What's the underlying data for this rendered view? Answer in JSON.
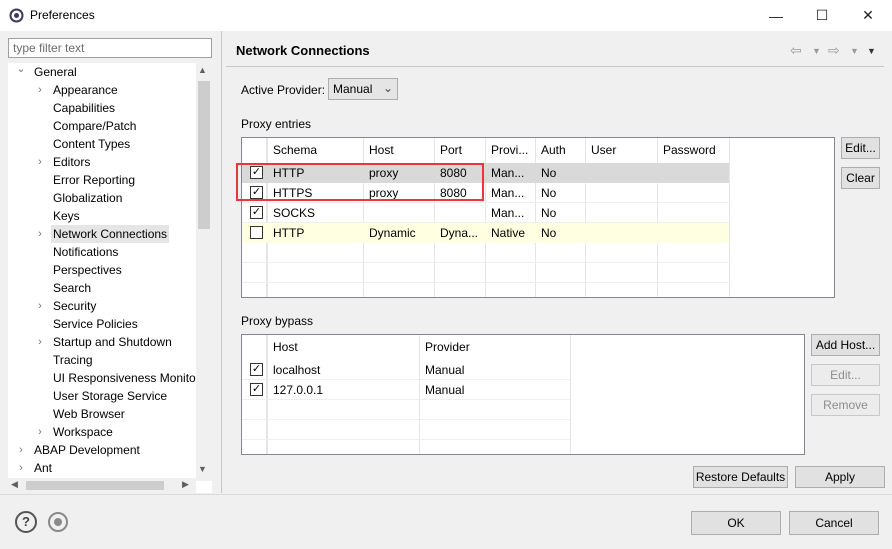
{
  "window": {
    "title": "Preferences",
    "minimize": "—",
    "maximize": "☐",
    "close": "✕"
  },
  "filter": {
    "placeholder": "type filter text"
  },
  "tree": [
    {
      "label": "General",
      "expander": "expanded"
    },
    {
      "label": "Appearance",
      "expander": "collapsed"
    },
    {
      "label": "Capabilities"
    },
    {
      "label": "Compare/Patch"
    },
    {
      "label": "Content Types"
    },
    {
      "label": "Editors",
      "expander": "collapsed"
    },
    {
      "label": "Error Reporting"
    },
    {
      "label": "Globalization"
    },
    {
      "label": "Keys"
    },
    {
      "label": "Network Connections",
      "expander": "collapsed",
      "selected": true
    },
    {
      "label": "Notifications"
    },
    {
      "label": "Perspectives"
    },
    {
      "label": "Search"
    },
    {
      "label": "Security",
      "expander": "collapsed"
    },
    {
      "label": "Service Policies"
    },
    {
      "label": "Startup and Shutdown",
      "expander": "collapsed"
    },
    {
      "label": "Tracing"
    },
    {
      "label": "UI Responsiveness Monitori"
    },
    {
      "label": "User Storage Service"
    },
    {
      "label": "Web Browser"
    },
    {
      "label": "Workspace",
      "expander": "collapsed"
    },
    {
      "label": "ABAP Development",
      "expander": "collapsed"
    },
    {
      "label": "Ant",
      "expander": "collapsed"
    }
  ],
  "page": {
    "title": "Network Connections",
    "active_provider_label": "Active Provider:",
    "active_provider_value": "Manual",
    "proxy_entries_label": "Proxy entries",
    "proxy_bypass_label": "Proxy bypass"
  },
  "proxy_entries": {
    "columns": [
      "Schema",
      "Host",
      "Port",
      "Provi...",
      "Auth",
      "User",
      "Password"
    ],
    "rows": [
      {
        "checked": true,
        "cells": [
          "HTTP",
          "proxy",
          "8080",
          "Man...",
          "No",
          "",
          ""
        ],
        "highlight": "selected"
      },
      {
        "checked": true,
        "cells": [
          "HTTPS",
          "proxy",
          "8080",
          "Man...",
          "No",
          "",
          ""
        ],
        "highlight": "none"
      },
      {
        "checked": true,
        "cells": [
          "SOCKS",
          "",
          "",
          "Man...",
          "No",
          "",
          ""
        ],
        "highlight": "none"
      },
      {
        "checked": false,
        "cells": [
          "HTTP",
          "Dynamic",
          "Dyna...",
          "Native",
          "No",
          "",
          ""
        ],
        "highlight": "native"
      }
    ],
    "buttons": {
      "edit": "Edit...",
      "clear": "Clear"
    }
  },
  "proxy_bypass": {
    "columns": [
      "Host",
      "Provider"
    ],
    "rows": [
      {
        "checked": true,
        "cells": [
          "localhost",
          "Manual"
        ]
      },
      {
        "checked": true,
        "cells": [
          "127.0.0.1",
          "Manual"
        ]
      }
    ],
    "buttons": {
      "add_host": "Add Host...",
      "edit": "Edit...",
      "remove": "Remove"
    }
  },
  "footer": {
    "restore_defaults": "Restore Defaults",
    "apply": "Apply",
    "ok": "OK",
    "cancel": "Cancel"
  },
  "colors": {
    "annotation": "#e8383d",
    "selection": "#d9d9d9",
    "native_row": "#ffffe1",
    "tree_selection": "#e5e5e5"
  }
}
